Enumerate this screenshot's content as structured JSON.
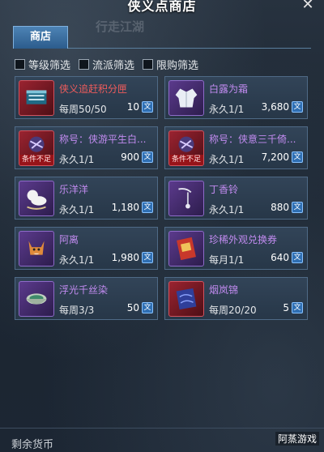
{
  "window": {
    "title": "侠义点商店"
  },
  "background_text": {
    "faint_title": "行走江湖",
    "faint_list": [
      "",
      "",
      ""
    ]
  },
  "tabs": [
    {
      "label": "商店"
    }
  ],
  "filters": [
    {
      "label": "等级筛选",
      "checked": false
    },
    {
      "label": "流派筛选",
      "checked": false
    },
    {
      "label": "限购筛选",
      "checked": false
    }
  ],
  "items": [
    {
      "name": "侠义追赶积分匣",
      "name_color": "red",
      "limit": "每周50/50",
      "price": "10",
      "icon": "book-box-icon",
      "rarity": "red",
      "condition": ""
    },
    {
      "name": "白露为霜",
      "name_color": "purple",
      "limit": "永久1/1",
      "price": "3,680",
      "icon": "white-robe-icon",
      "rarity": "purple",
      "condition": ""
    },
    {
      "name": "称号：侠游平生白...",
      "name_color": "purple",
      "limit": "永久1/1",
      "price": "900",
      "icon": "title-badge-icon",
      "rarity": "red",
      "condition": "条件不足"
    },
    {
      "name": "称号：侠意三千倚...",
      "name_color": "purple",
      "limit": "永久1/1",
      "price": "7,200",
      "icon": "title-badge-icon",
      "rarity": "red",
      "condition": "条件不足"
    },
    {
      "name": "乐洋洋",
      "name_color": "purple",
      "limit": "永久1/1",
      "price": "1,180",
      "icon": "rocking-toy-icon",
      "rarity": "purple",
      "condition": ""
    },
    {
      "name": "丁香铃",
      "name_color": "purple",
      "limit": "永久1/1",
      "price": "880",
      "icon": "bell-icon",
      "rarity": "purple",
      "condition": ""
    },
    {
      "name": "阿离",
      "name_color": "purple",
      "limit": "永久1/1",
      "price": "1,980",
      "icon": "fox-pet-icon",
      "rarity": "purple",
      "condition": ""
    },
    {
      "name": "珍稀外观兑换券",
      "name_color": "purple",
      "limit": "每月1/1",
      "price": "640",
      "icon": "voucher-icon",
      "rarity": "purple",
      "condition": ""
    },
    {
      "name": "浮光千丝染",
      "name_color": "purple",
      "limit": "每周3/3",
      "price": "50",
      "icon": "dye-bowl-icon",
      "rarity": "purple",
      "condition": ""
    },
    {
      "name": "烟岚锦",
      "name_color": "purple",
      "limit": "每周20/20",
      "price": "5",
      "icon": "silk-cloth-icon",
      "rarity": "red",
      "condition": ""
    }
  ],
  "currency": {
    "symbol": "文",
    "remaining_label": "剩余货币"
  },
  "watermark": "阿蒸游戏",
  "colors": {
    "red_name": "#f05c5c",
    "purple_name": "#c28bf0",
    "tab_blue": "#3a6ea0"
  }
}
